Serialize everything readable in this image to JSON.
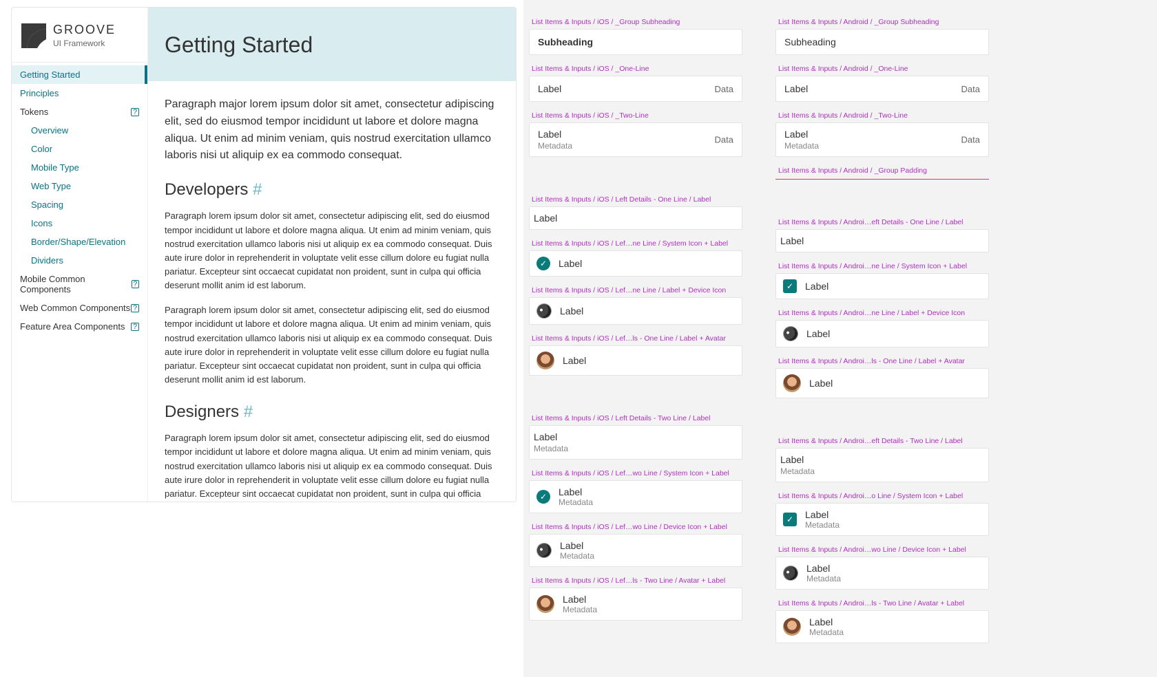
{
  "brand": {
    "title": "GROOVE",
    "subtitle": "UI Framework"
  },
  "nav": {
    "getting_started": "Getting Started",
    "principles": "Principles",
    "tokens": "Tokens",
    "tokens_children": {
      "overview": "Overview",
      "color": "Color",
      "mobile_type": "Mobile Type",
      "web_type": "Web Type",
      "spacing": "Spacing",
      "icons": "Icons",
      "border_shape": "Border/Shape/Elevation",
      "dividers": "Dividers"
    },
    "mobile_common": "Mobile Common Components",
    "web_common": "Web Common Components",
    "feature_area": "Feature Area Components"
  },
  "doc": {
    "title": "Getting Started",
    "intro": "Paragraph major lorem ipsum dolor sit amet, consectetur adipiscing elit, sed do eiusmod tempor incididunt ut labore et dolore magna aliqua. Ut enim ad minim veniam, quis nostrud exercitation ullamco laboris nisi ut aliquip ex ea commodo consequat.",
    "h_dev": "Developers",
    "h_des": "Designers",
    "anchor": "#",
    "para": "Paragraph lorem ipsum dolor sit amet, consectetur adipiscing elit, sed do eiusmod tempor incididunt ut labore et dolore magna aliqua. Ut enim ad minim veniam, quis nostrud exercitation ullamco laboris nisi ut aliquip ex ea commodo consequat. Duis aute irure dolor in reprehenderit in voluptate velit esse cillum dolore eu fugiat nulla pariatur. Excepteur sint occaecat cupidatat non proident, sunt in culpa qui officia deserunt mollit anim id est laborum."
  },
  "labels": {
    "ios": {
      "group_sub": "List Items & Inputs / iOS / _Group Subheading",
      "one": "List Items & Inputs / iOS / _One-Line",
      "two": "List Items & Inputs / iOS / _Two-Line",
      "ld1_label": "List Items & Inputs / iOS / Left Details - One Line / Label",
      "ld1_sys": "List Items & Inputs / iOS / Lef…ne Line / System Icon + Label",
      "ld1_dev": "List Items & Inputs / iOS / Lef…ne Line / Label + Device Icon",
      "ld1_av": "List Items & Inputs / iOS / Lef…ls - One Line / Label + Avatar",
      "ld2_label": "List Items & Inputs / iOS / Left Details - Two Line / Label",
      "ld2_sys": "List Items & Inputs / iOS / Lef…wo Line / System Icon + Label",
      "ld2_dev": "List Items & Inputs / iOS / Lef…wo Line / Device Icon + Label",
      "ld2_av": "List Items & Inputs / iOS / Lef…ls - Two Line / Avatar + Label"
    },
    "and": {
      "group_sub": "List Items & Inputs / Android / _Group Subheading",
      "one": "List Items & Inputs / Android / _One-Line",
      "two": "List Items & Inputs / Android / _Two-Line",
      "pad": "List Items & Inputs / Android / _Group Padding",
      "ld1_label": "List Items & Inputs / Androi…eft Details - One Line / Label",
      "ld1_sys": "List Items & Inputs / Androi…ne Line / System Icon + Label",
      "ld1_dev": "List Items & Inputs / Androi…ne Line / Label + Device Icon",
      "ld1_av": "List Items & Inputs / Androi…ls - One Line / Label + Avatar",
      "ld2_label": "List Items & Inputs / Androi…eft Details - Two Line / Label",
      "ld2_sys": "List Items & Inputs / Androi…o Line / System Icon + Label",
      "ld2_dev": "List Items & Inputs / Androi…wo Line / Device Icon + Label",
      "ld2_av": "List Items & Inputs / Androi…ls - Two Line / Avatar + Label"
    }
  },
  "row": {
    "subheading": "Subheading",
    "label": "Label",
    "data": "Data",
    "metadata": "Metadata"
  }
}
